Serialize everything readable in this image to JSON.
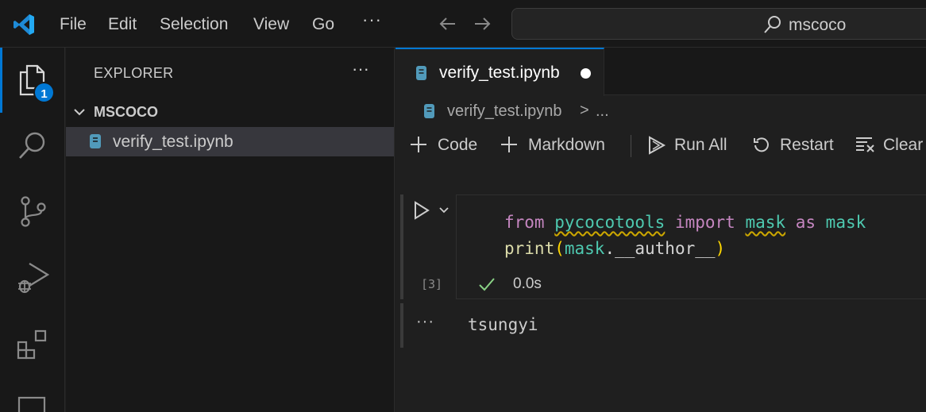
{
  "menu": {
    "items": [
      "File",
      "Edit",
      "Selection",
      "View",
      "Go"
    ],
    "more": "···"
  },
  "command_center": {
    "text": "mscoco"
  },
  "activity_bar": {
    "explorer_badge": "1",
    "icons": [
      "files-icon",
      "search-icon",
      "source-control-icon",
      "run-debug-icon",
      "extensions-icon",
      "remote-explorer-icon"
    ]
  },
  "sidebar": {
    "title": "EXPLORER",
    "more": "···",
    "folder": "MSCOCO",
    "file": "verify_test.ipynb"
  },
  "editor": {
    "tab_label": "verify_test.ipynb",
    "breadcrumb": {
      "file": "verify_test.ipynb",
      "separator": ">",
      "more": "..."
    },
    "toolbar": {
      "code": "Code",
      "markdown": "Markdown",
      "run_all": "Run All",
      "restart": "Restart",
      "clear": "Clear"
    },
    "cell": {
      "line1": {
        "from": "from",
        "module": "pycocotools",
        "import": "import",
        "name": "mask",
        "as": "as",
        "alias": "mask"
      },
      "line2": {
        "fn": "print",
        "open": "(",
        "obj": "mask",
        "attr": ".__author__",
        "close": ")"
      },
      "exec_count": "[3]",
      "status_time": "0.0s"
    },
    "output": {
      "more": "···",
      "text": "tsungyi"
    }
  },
  "colors": {
    "accent": "#0078d4",
    "keyword": "#c586c0",
    "identifier": "#4ec9b0",
    "function": "#dcdcaa",
    "success": "#89d185"
  }
}
